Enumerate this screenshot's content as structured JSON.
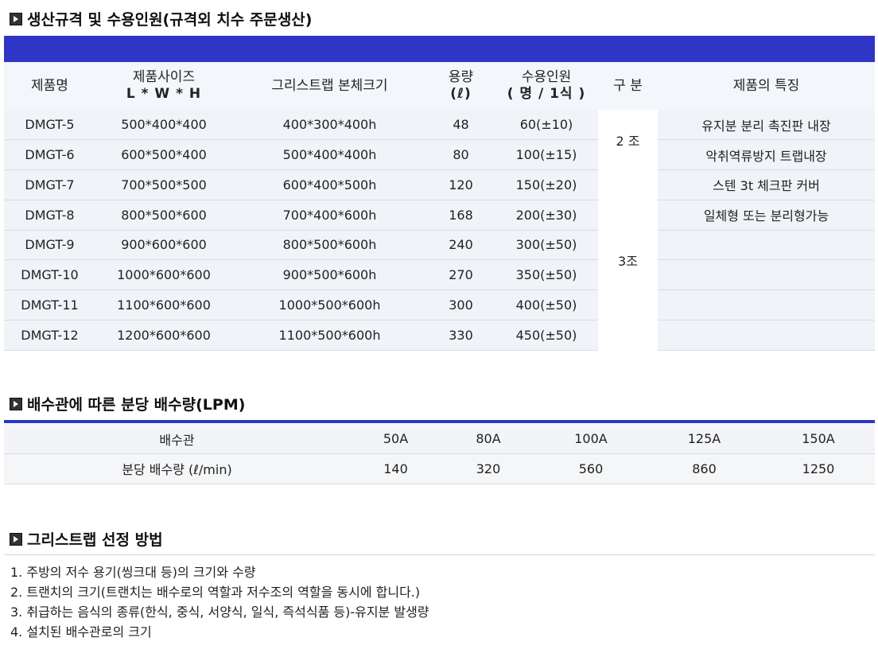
{
  "section1": {
    "title": "생산규격 및 수용인원(규격외 치수 주문생산)"
  },
  "spec_table": {
    "headers": {
      "name": "제품명",
      "size_line1": "제품사이즈",
      "size_line2": "L * W * H",
      "body_size": "그리스트랩 본체크기",
      "capacity_line1": "용량",
      "capacity_line2": "(ℓ)",
      "people_line1": "수용인원",
      "people_line2": "( 명 / 1식 )",
      "type": "구 분",
      "features": "제품의 특징"
    },
    "rows": [
      {
        "name": "DMGT-5",
        "size": "500*400*400",
        "body": "400*300*400h",
        "capacity": "48",
        "people": "60(±10)"
      },
      {
        "name": "DMGT-6",
        "size": "600*500*400",
        "body": "500*400*400h",
        "capacity": "80",
        "people": "100(±15)"
      },
      {
        "name": "DMGT-7",
        "size": "700*500*500",
        "body": "600*400*500h",
        "capacity": "120",
        "people": "150(±20)"
      },
      {
        "name": "DMGT-8",
        "size": "800*500*600",
        "body": "700*400*600h",
        "capacity": "168",
        "people": "200(±30)"
      },
      {
        "name": "DMGT-9",
        "size": "900*600*600",
        "body": "800*500*600h",
        "capacity": "240",
        "people": "300(±50)"
      },
      {
        "name": "DMGT-10",
        "size": "1000*600*600",
        "body": "900*500*600h",
        "capacity": "270",
        "people": "350(±50)"
      },
      {
        "name": "DMGT-11",
        "size": "1100*600*600",
        "body": "1000*500*600h",
        "capacity": "300",
        "people": "400(±50)"
      },
      {
        "name": "DMGT-12",
        "size": "1200*600*600",
        "body": "1100*500*600h",
        "capacity": "330",
        "people": "450(±50)"
      }
    ],
    "type_groups": [
      "2 조",
      "3조"
    ],
    "features": [
      "유지분 분리 촉진판 내장",
      "악취역류방지 트랩내장",
      "스텐 3t 체크판 커버",
      "일체형 또는 분리형가능"
    ]
  },
  "section2": {
    "title": "배수관에 따른 분당 배수량(LPM)"
  },
  "flow_table": {
    "row1_label": "배수관",
    "row2_label": "분당 배수량 (ℓ/min)",
    "pipes": [
      "50A",
      "80A",
      "100A",
      "125A",
      "150A"
    ],
    "flows": [
      "140",
      "320",
      "560",
      "860",
      "1250"
    ]
  },
  "section3": {
    "title": "그리스트랩 선정 방법",
    "items": [
      "1. 주방의 저수 용기(씽크대 등)의 크기와 수량",
      "2. 트랜치의 크기(트랜치는 배수로의 역할과 저수조의 역할을 동시에 합니다.)",
      "3. 취급하는 음식의 종류(한식, 중식, 서양식, 일식, 즉석식품 등)-유지분 발생량",
      "4. 설치된 배수관로의 크기"
    ]
  },
  "colors": {
    "accent": "#2e35c7",
    "header_bg": "#f3f6fa",
    "alt_bg": "#f0f3f7"
  }
}
